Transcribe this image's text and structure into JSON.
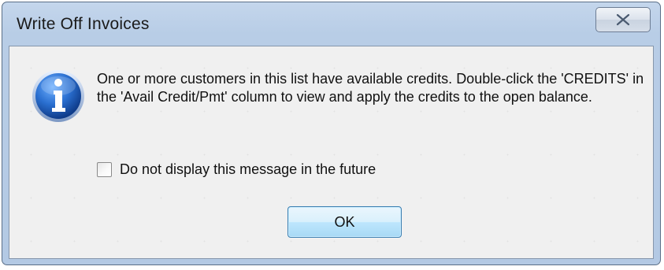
{
  "window": {
    "title": "Write Off Invoices"
  },
  "dialog": {
    "message": "One or more customers in this list have available credits. Double-click the 'CREDITS' in the 'Avail Credit/Pmt' column to view and apply the credits to the open balance.",
    "checkbox_label": "Do not display this message in the future",
    "checkbox_checked": false,
    "ok_label": "OK",
    "icon": "information-icon"
  },
  "colors": {
    "title_bar": "#b8cde6",
    "client_bg": "#f0f0f0",
    "info_icon_blue": "#1f5fbf",
    "ok_button_border": "#3c7fb1"
  }
}
